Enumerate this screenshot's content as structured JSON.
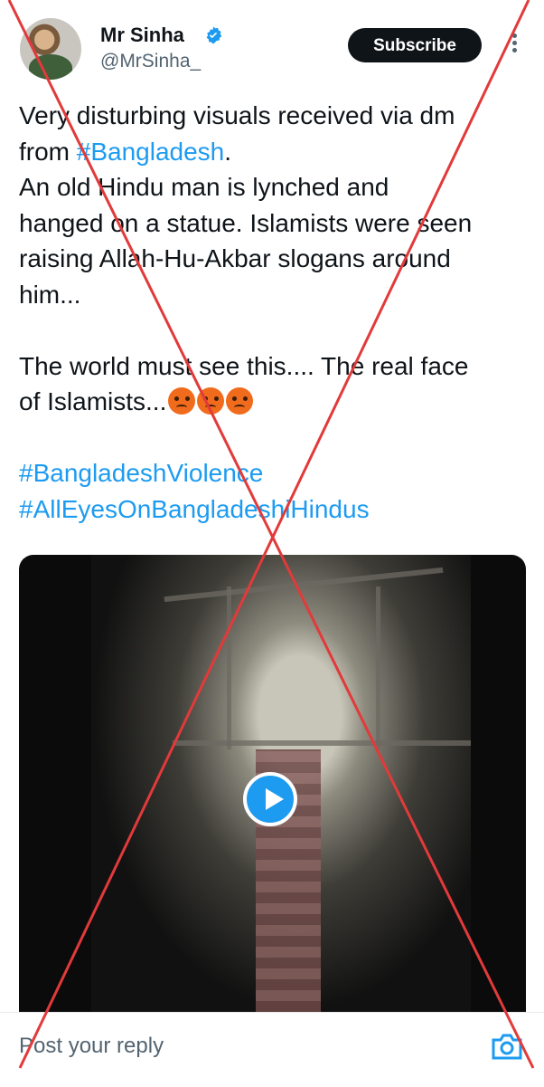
{
  "tweet": {
    "author_name": "Mr Sinha",
    "handle": "@MrSinha_",
    "subscribe_label": "Subscribe",
    "lines": [
      {
        "text": "Very disturbing visuals received via dm"
      },
      {
        "text_before": "from ",
        "hashtag": "#Bangladesh",
        "text_after": "."
      },
      {
        "text": "An old Hindu man is lynched and"
      },
      {
        "text": "hanged on a statue. Islamists were seen"
      },
      {
        "text": "raising Allah-Hu-Akbar slogans around"
      },
      {
        "text": "him..."
      },
      {
        "text": "The world must see this.... The real face"
      },
      {
        "text": "of Islamists..."
      }
    ],
    "hashtags": [
      "#BangladeshViolence",
      "#AllEyesOnBangladeshiHindus"
    ],
    "emoji": [
      "angry-face",
      "angry-face",
      "angry-face"
    ]
  },
  "media": {
    "type": "video",
    "play_icon": "play-icon"
  },
  "reply_bar": {
    "placeholder": "Post your reply",
    "camera_icon": "camera-icon"
  },
  "colors": {
    "accent": "#1d9bf0",
    "cross": "#e23a3a"
  }
}
